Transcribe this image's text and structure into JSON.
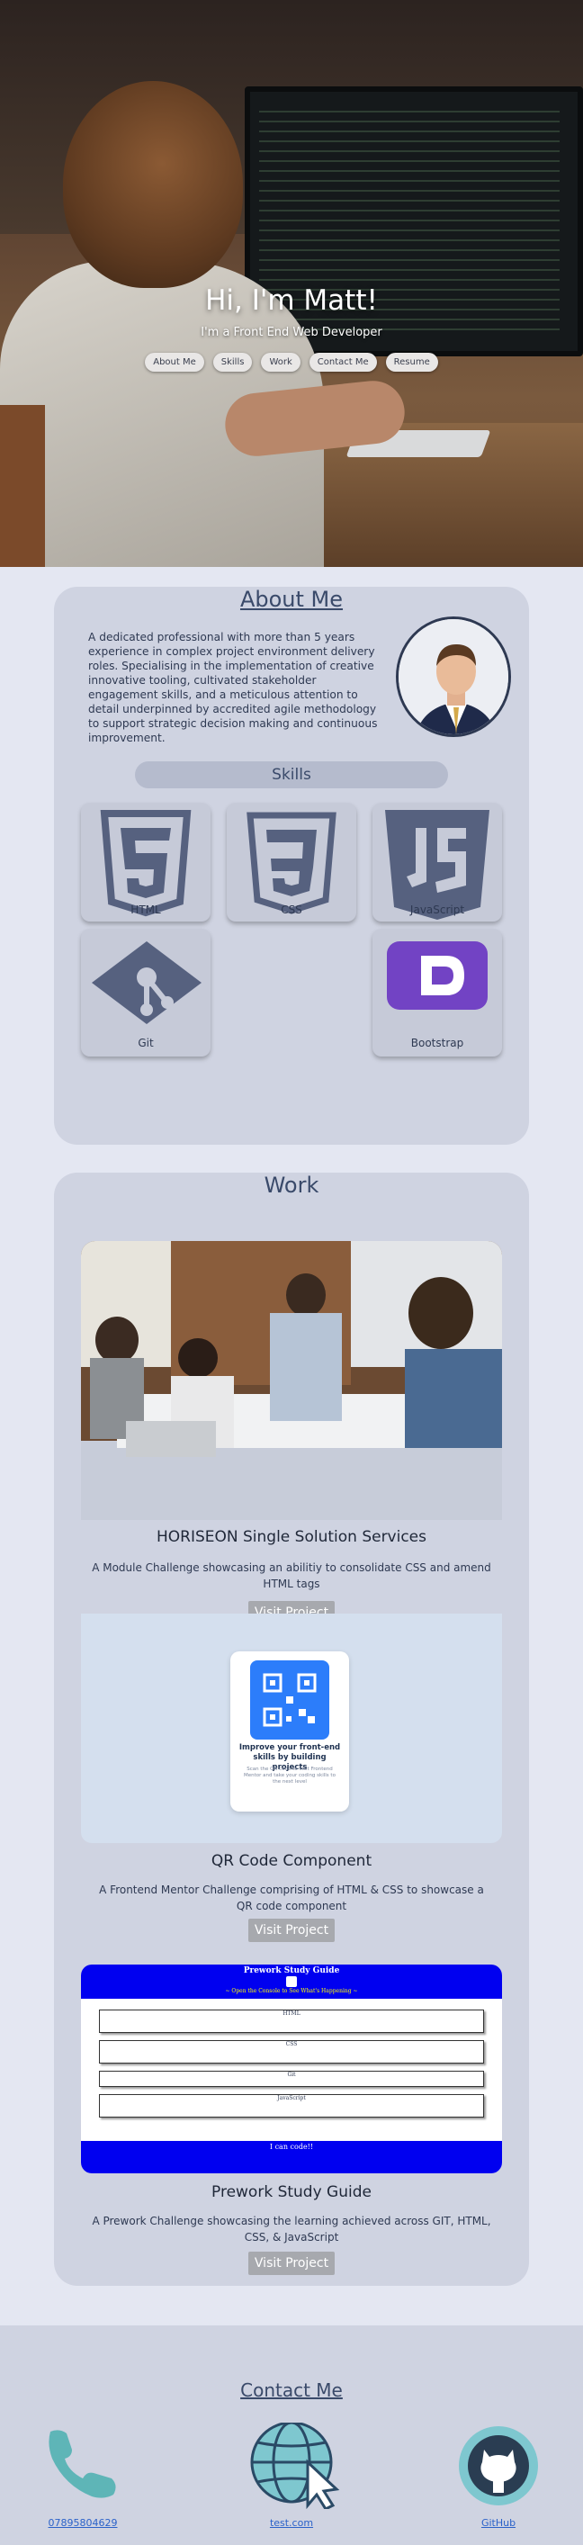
{
  "hero": {
    "name": "Hi, I'm Matt!",
    "subtitle": "I'm a Front End Web Developer",
    "nav": [
      "About Me",
      "Skills",
      "Work",
      "Contact Me",
      "Resume"
    ]
  },
  "about": {
    "title": "About Me",
    "text": "A dedicated professional with more than 5 years experience in complex project environment delivery roles. Specialising in the implementation of creative innovative tooling, cultivated stakeholder engagement skills, and a meticulous attention to detail underpinned by accredited agile methodology to support strategic decision making and continuous improvement."
  },
  "skills": {
    "title": "Skills",
    "items": [
      {
        "label": "HTML",
        "icon": "html5-icon"
      },
      {
        "label": "CSS",
        "icon": "css3-icon"
      },
      {
        "label": "JavaScript",
        "icon": "javascript-icon"
      },
      {
        "label": "Git",
        "icon": "git-icon"
      },
      {
        "label": "Bootstrap",
        "icon": "bootstrap-icon"
      }
    ]
  },
  "work": {
    "title": "Work",
    "projects": [
      {
        "title": "HORISEON Single Solution Services",
        "desc": "A Module Challenge showcasing an abilitiy to consolidate CSS and amend HTML tags",
        "button": "Visit Project"
      },
      {
        "title": "QR Code Component",
        "desc": "A Frontend Mentor Challenge comprising of HTML & CSS to showcase a QR code component",
        "button": "Visit Project",
        "preview": {
          "heading": "Improve your front-end skills by building projects",
          "text": "Scan the QR code to visit Frontend Mentor and take your coding skills to the next level"
        }
      },
      {
        "title": "Prework Study Guide",
        "desc": "A Prework Challenge showcasing the learning achieved across GIT, HTML, CSS, & JavaScript",
        "button": "Visit Project",
        "preview": {
          "heading": "Prework Study Guide",
          "sub": "~ Open the Console to See What's Happening ~",
          "sections": [
            "HTML",
            "CSS",
            "Git",
            "JavaScript"
          ],
          "footer": "I can code!!"
        }
      }
    ]
  },
  "contact": {
    "title": "Contact Me",
    "phone": "07895804629",
    "web": "test.com",
    "github": "GitHub"
  },
  "colors": {
    "accent": "#3a4a6a",
    "card": "#cfd3e1",
    "page": "#e4e7f2"
  }
}
